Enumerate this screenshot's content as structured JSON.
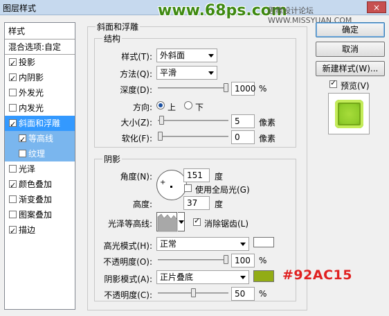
{
  "window": {
    "title": "图层样式",
    "close": "×"
  },
  "watermark": {
    "site": "www.68ps.com",
    "forum": "思缘设计论坛 WWW.MISSYUAN.COM",
    "hex_note": "#92AC15"
  },
  "stylelist": {
    "header": "样式",
    "blend": "混合选项:自定",
    "items": [
      {
        "label": "投影",
        "checked": true
      },
      {
        "label": "内阴影",
        "checked": true
      },
      {
        "label": "外发光",
        "checked": false
      },
      {
        "label": "内发光",
        "checked": false
      },
      {
        "label": "斜面和浮雕",
        "checked": true
      },
      {
        "label": "等高线",
        "checked": true
      },
      {
        "label": "纹理",
        "checked": false
      },
      {
        "label": "光泽",
        "checked": false
      },
      {
        "label": "颜色叠加",
        "checked": true
      },
      {
        "label": "渐变叠加",
        "checked": false
      },
      {
        "label": "图案叠加",
        "checked": false
      },
      {
        "label": "描边",
        "checked": true
      }
    ]
  },
  "bevel": {
    "group_title": "斜面和浮雕",
    "structure_title": "结构",
    "style_label": "样式(T):",
    "style_value": "外斜面",
    "method_label": "方法(Q):",
    "method_value": "平滑",
    "depth_label": "深度(D):",
    "depth_value": "1000",
    "depth_unit": "%",
    "direction_label": "方向:",
    "dir_up": "上",
    "dir_down": "下",
    "size_label": "大小(Z):",
    "size_value": "5",
    "size_unit": "像素",
    "soften_label": "软化(F):",
    "soften_value": "0",
    "soften_unit": "像素"
  },
  "shading": {
    "title": "阴影",
    "angle_label": "角度(N):",
    "angle_value": "151",
    "angle_unit": "度",
    "global_light": "使用全局光(G)",
    "altitude_label": "高度:",
    "altitude_value": "37",
    "altitude_unit": "度",
    "gloss_label": "光泽等高线:",
    "antialias": "消除锯齿(L)",
    "highlight_label": "高光模式(H):",
    "highlight_value": "正常",
    "hl_opacity_label": "不透明度(O):",
    "hl_opacity_value": "100",
    "hl_opacity_unit": "%",
    "shadow_label": "阴影模式(A):",
    "shadow_value": "正片叠底",
    "sh_opacity_label": "不透明度(C):",
    "sh_opacity_value": "50",
    "sh_opacity_unit": "%",
    "highlight_color": "#ffffff",
    "shadow_color": "#92ac15"
  },
  "buttons": {
    "ok": "确定",
    "cancel": "取消",
    "new_style": "新建样式(W)...",
    "preview": "预览(V)"
  },
  "slider_levels": {
    "depth": 1.0,
    "size": 0.02,
    "soften": 0.0,
    "hl_opacity": 1.0,
    "sh_opacity": 0.5
  }
}
